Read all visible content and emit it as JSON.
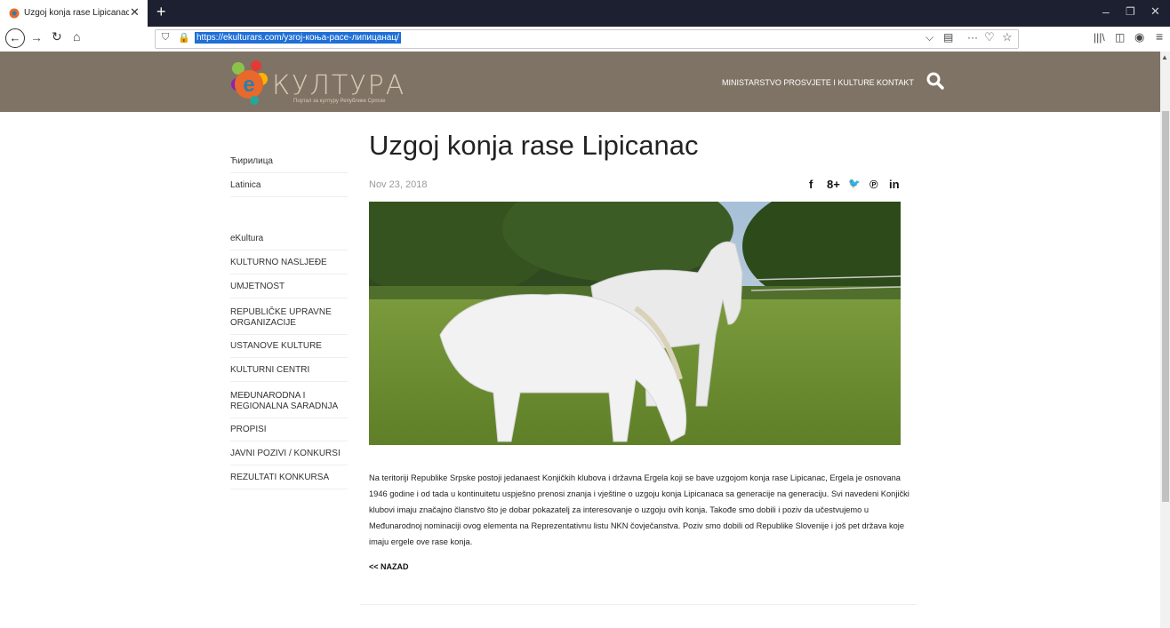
{
  "browser": {
    "tab_title": "Uzgoj konja rase Lipicanac – Po",
    "tab_close": "✕",
    "new_tab": "+",
    "url": "https://ekulturars.com/узгој-коња-расе-липицанац/",
    "window": {
      "minimize": "–",
      "maximize": "❐",
      "close": "✕"
    },
    "icons": {
      "back": "←",
      "forward": "→",
      "reload": "↻",
      "home": "⌂",
      "shield": "⛉",
      "lock": "🔒",
      "dropdown": "⌵",
      "reader": "▤",
      "more": "···",
      "pocket": "♡",
      "star": "☆",
      "library": "|||\\",
      "sidebar": "◫",
      "account": "◉",
      "menu": "≡",
      "scroll_up": "▲"
    }
  },
  "site": {
    "logo_text": "КУЛТУРА",
    "logo_tagline": "Портал за културу Републике Српске",
    "nav": {
      "ministry": "MINISTARSTVO PROSVJETE I KULTURE",
      "contact": "KONTAKT"
    },
    "colors": {
      "header": "#7f7365",
      "logo_orange": "#e8692b",
      "logo_teal": "#2b7fa8"
    }
  },
  "sidebar": {
    "languages": [
      "Ћирилица",
      "Latinica"
    ],
    "items": [
      "eKultura",
      "KULTURNO NASLJEĐE",
      "UMJETNOST",
      "REPUBLIČKE UPRAVNE ORGANIZACIJE",
      "USTANOVE KULTURE",
      "KULTURNI CENTRI",
      "MEĐUNARODNA I REGIONALNA SARADNJA",
      "PROPISI",
      "JAVNI POZIVI / KONKURSI",
      "REZULTATI KONKURSA"
    ]
  },
  "article": {
    "title": "Uzgoj konja rase Lipicanac",
    "date": "Nov 23, 2018",
    "share": {
      "facebook": "f",
      "google": "8+",
      "twitter": "🐦",
      "pinterest": "℗",
      "linkedin": "in"
    },
    "body": "Na teritoriji Republike Srpske postoji jedanaest Konjičkih klubova i državna Ergela koji se bave uzgojom konja rase Lipicanac, Ergela je osnovana 1946 godine i od tada u kontinuitetu uspješno prenosi znanja i vještine o uzgoju konja Lipicanaca sa generacije na generaciju. Svi navedeni Konjički klubovi imaju značajno članstvo što je dobar pokazatelj za interesovanje o uzgoju ovih konja. Takođe smo dobili i poziv da učestvujemo u Međunarodnoj nominaciji ovog elementa na Reprezentativnu listu NKN čovječanstva. Poziv smo dobili od Republike Slovenije i još pet država koje imaju ergele ove rase konja.",
    "back_link": "<< NAZAD"
  }
}
